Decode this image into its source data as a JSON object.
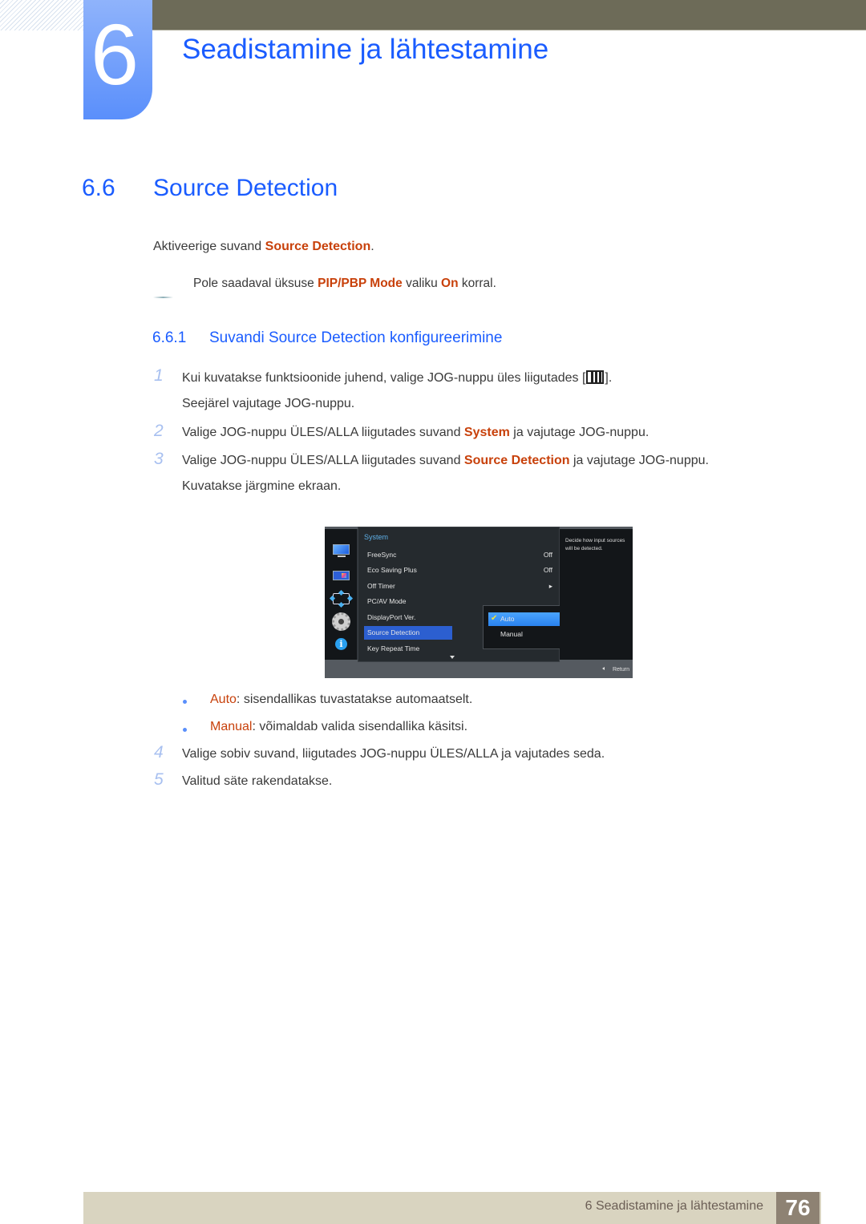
{
  "header": {
    "chapter_number": "6",
    "chapter_title": "Seadistamine ja lähtestamine"
  },
  "section": {
    "number": "6.6",
    "title": "Source Detection",
    "intro_pre": "Aktiveerige suvand ",
    "intro_hl": "Source Detection",
    "intro_post": ".",
    "note": {
      "pre": "Pole saadaval üksuse ",
      "hl1": "PIP/PBP Mode",
      "mid": " valiku ",
      "hl2": "On",
      "post": " korral."
    }
  },
  "subsection": {
    "number": "6.6.1",
    "title": "Suvandi Source Detection konfigureerimine"
  },
  "steps": [
    {
      "num": "1",
      "line1_pre": "Kui kuvatakse funktsioonide juhend, valige JOG-nuppu üles liigutades [",
      "line1_post": "].",
      "line2": "Seejärel vajutage JOG-nuppu.",
      "icon": "menu-icon"
    },
    {
      "num": "2",
      "pre": "Valige JOG-nuppu ÜLES/ALLA liigutades suvand ",
      "hl": "System",
      "post": " ja vajutage JOG-nuppu."
    },
    {
      "num": "3",
      "pre": "Valige JOG-nuppu ÜLES/ALLA liigutades suvand ",
      "hl": "Source Detection",
      "post": " ja vajutage JOG-nuppu.",
      "line2": "Kuvatakse järgmine ekraan."
    },
    {
      "num": "4",
      "text": "Valige sobiv suvand, liigutades JOG-nuppu ÜLES/ALLA ja vajutades seda."
    },
    {
      "num": "5",
      "text": "Valitud säte rakendatakse."
    }
  ],
  "bullets": [
    {
      "hl": "Auto",
      "text": ": sisendallikas tuvastatakse automaatselt."
    },
    {
      "hl": "Manual",
      "text": ": võimaldab valida sisendallika käsitsi."
    }
  ],
  "osd": {
    "title": "System",
    "side_icons": [
      "monitor-icon",
      "picture-icon",
      "size-position-icon",
      "gear-icon",
      "info-icon"
    ],
    "items": [
      {
        "label": "FreeSync",
        "value": "Off"
      },
      {
        "label": "Eco Saving Plus",
        "value": "Off"
      },
      {
        "label": "Off Timer",
        "value": "▸"
      },
      {
        "label": "PC/AV Mode",
        "value": ""
      },
      {
        "label": "DisplayPort Ver.",
        "value": ""
      },
      {
        "label": "Source Detection",
        "value": "",
        "selected": true
      },
      {
        "label": "Key Repeat Time",
        "value": ""
      }
    ],
    "submenu": [
      {
        "label": "Auto",
        "selected": true,
        "checked": true
      },
      {
        "label": "Manual",
        "selected": false
      }
    ],
    "help_text": "Decide how input sources will be detected.",
    "return_label": "Return"
  },
  "colors": {
    "heading_blue": "#1a5cff",
    "highlight_orange": "#c8410b",
    "osd_selection": "#2c5fd0"
  },
  "footer": {
    "text": "6 Seadistamine ja lähtestamine",
    "page": "76"
  }
}
